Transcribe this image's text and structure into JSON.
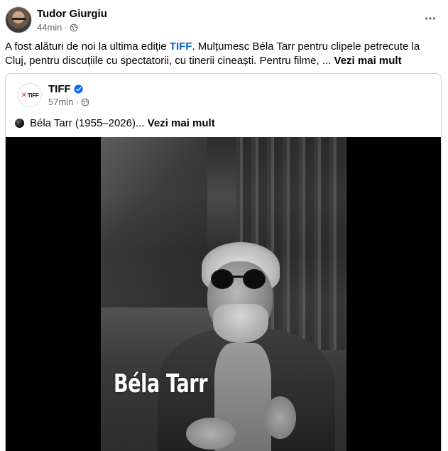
{
  "post": {
    "author": "Tudor Giurgiu",
    "time": "44min",
    "separator": "·",
    "text_before_link": "A fost alături de noi la ultima ediție ",
    "link_text": "TIFF",
    "text_after_link": ". Mulțumesc Béla Tarr pentru clipele petrecute la Cluj, pentru discuțiile cu spectatorii, cu tinerii cineaști. Pentru filme, ... ",
    "see_more": "Vezi mai mult"
  },
  "shared": {
    "logo_text": "TIFF",
    "page_name": "TIFF",
    "time": "57min",
    "separator": "·",
    "text": "Béla Tarr (1955–2026)... ",
    "see_more": "Vezi mai mult",
    "photo_caption": "Béla Tarr"
  },
  "colors": {
    "link": "#0064d1",
    "secondary_text": "#65676b",
    "verified": "#0866ff",
    "border": "#ced0d4"
  },
  "icons": {
    "globe": "globe-icon",
    "more": "more-horizontal-icon",
    "verified": "verified-badge-icon"
  }
}
